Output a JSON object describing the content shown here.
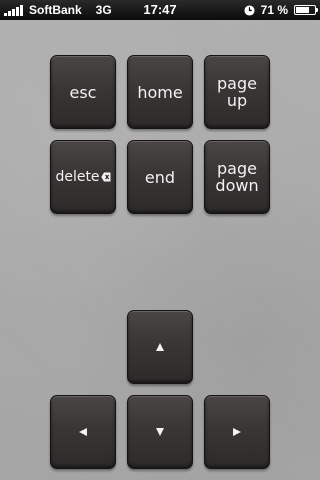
{
  "status_bar": {
    "carrier": "SoftBank",
    "network": "3G",
    "time": "17:47",
    "battery_percent_text": "71 %",
    "battery_level": 0.71
  },
  "keys": {
    "esc": "esc",
    "home": "home",
    "page_up": "page\nup",
    "delete": "delete",
    "end": "end",
    "page_down": "page\ndown"
  },
  "icons": {
    "delete": "delete-backspace-icon",
    "up": "arrow-up-icon",
    "down": "arrow-down-icon",
    "left": "arrow-left-icon",
    "right": "arrow-right-icon",
    "clock": "clock-icon",
    "battery": "battery-icon",
    "signal": "signal-icon"
  }
}
